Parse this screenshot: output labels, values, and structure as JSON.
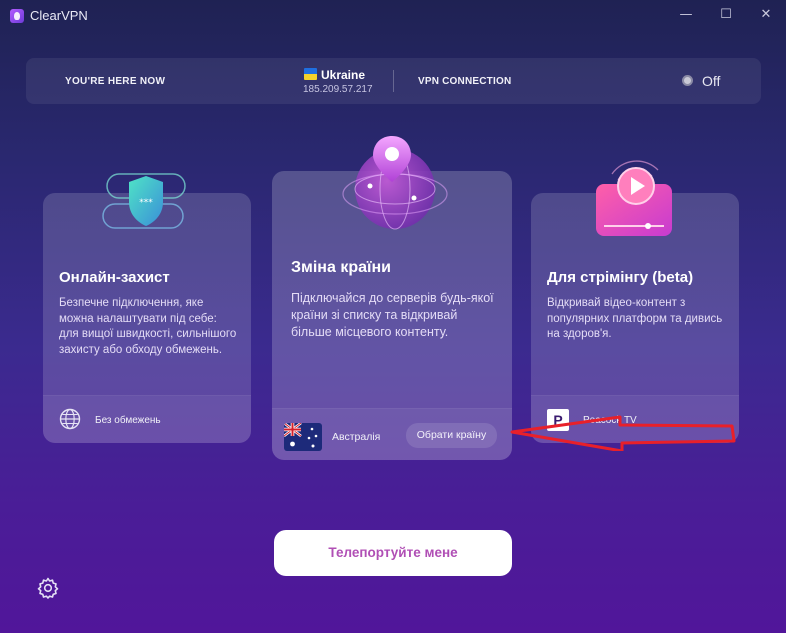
{
  "window": {
    "title": "ClearVPN",
    "controls": {
      "minimize": "—",
      "maximize": "☐",
      "close": "✕"
    }
  },
  "status": {
    "here_label": "YOU'RE HERE NOW",
    "country": "Ukraine",
    "ip": "185.209.57.217",
    "vpn_label": "VPN CONNECTION",
    "vpn_state": "Off"
  },
  "cards": {
    "protection": {
      "title": "Онлайн-захист",
      "description": "Безпечне підключення, яке можна налаштувати під себе: для вищої швидкості, сильнішого захисту або обходу обмежень.",
      "footer": "Без обмежень"
    },
    "country": {
      "title": "Зміна країни",
      "description": "Підключайся до серверів будь-якої країни зі списку та відкривай більше місцевого контенту.",
      "selected_country": "Австралія",
      "choose_button": "Обрати країну"
    },
    "streaming": {
      "title": "Для стрімінгу (beta)",
      "description": "Відкривай відео-контент з популярних платформ та дивись на здоров'я.",
      "platform_logo_letter": "P",
      "footer": "Peacock TV"
    }
  },
  "actions": {
    "teleport_button": "Телепортуйте мене"
  },
  "colors": {
    "accent": "#b04fb5",
    "annotation_arrow": "#e8202a"
  }
}
